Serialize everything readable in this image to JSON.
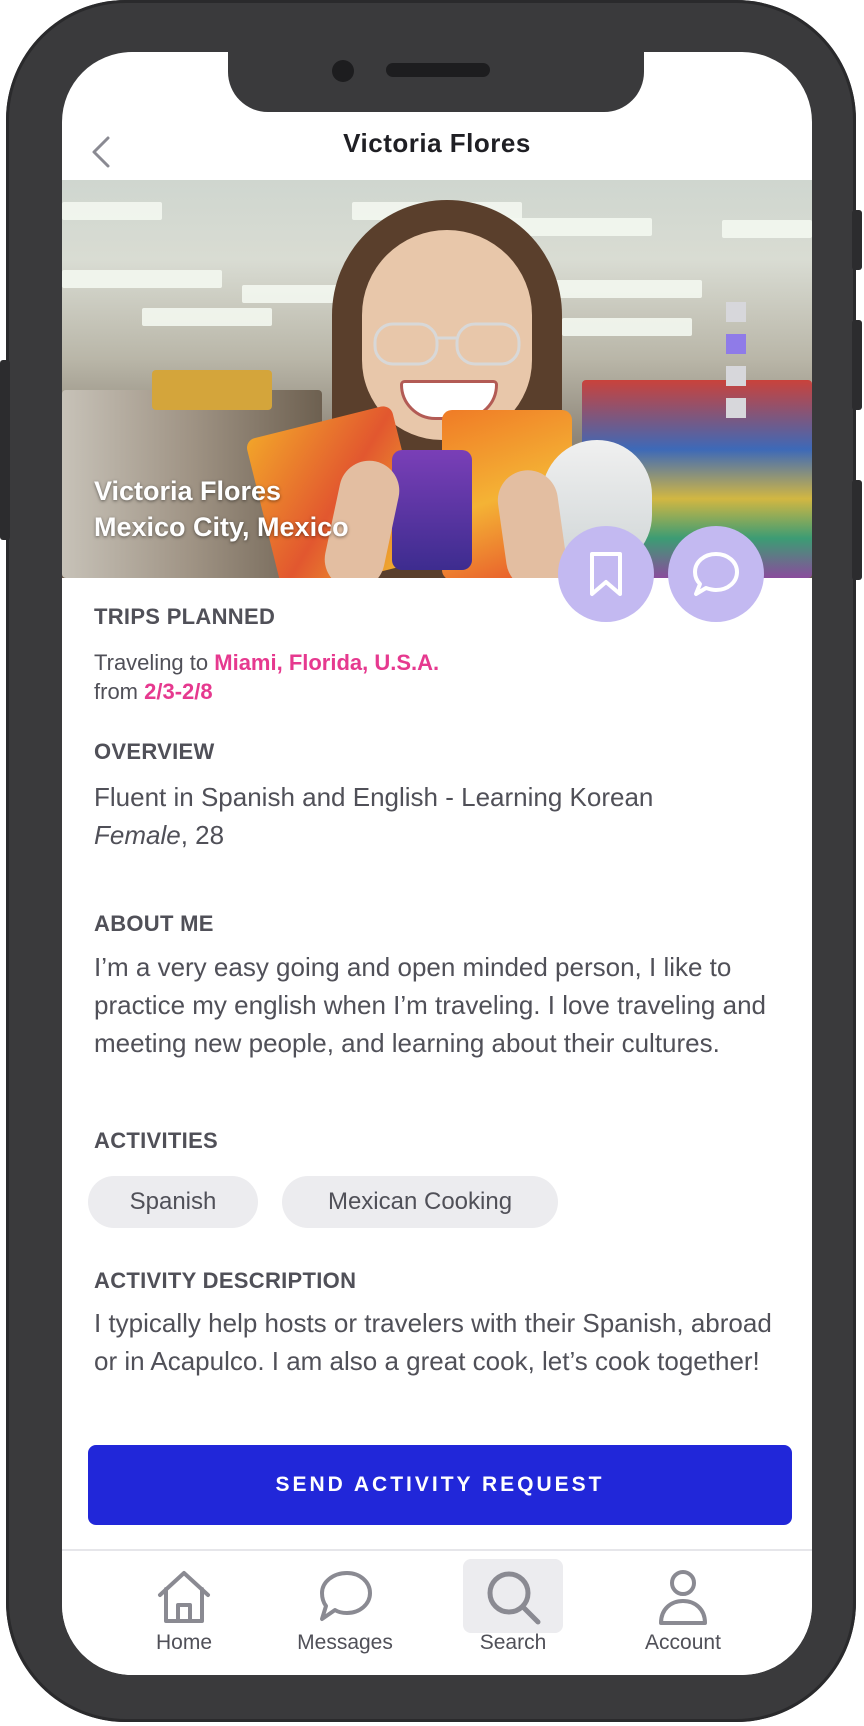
{
  "header": {
    "title": "Victoria Flores"
  },
  "profile": {
    "name": "Victoria Flores",
    "location": "Mexico City, Mexico",
    "photo_pages": 4,
    "active_photo": 2
  },
  "trips": {
    "label": "TRIPS PLANNED",
    "prefix": "Traveling to",
    "destination": "Miami, Florida, U.S.A.",
    "from_prefix": "from",
    "dates": "2/3-2/8"
  },
  "overview": {
    "label": "OVERVIEW",
    "languages": "Fluent in Spanish and English - Learning Korean",
    "gender": "Female",
    "age": ", 28"
  },
  "about": {
    "label": "ABOUT ME",
    "text": "I’m a very easy going and open minded person, I like to practice my english when I’m traveling. I love traveling and meeting new people, and learning about their cultures."
  },
  "activities": {
    "label": "ACTIVITIES",
    "items": [
      "Spanish",
      "Mexican Cooking"
    ]
  },
  "activity_description": {
    "label": "ACTIVITY DESCRIPTION",
    "text": "I typically help hosts or travelers with their Spanish, abroad or in Acapulco.  I am also a great cook, let’s cook together!"
  },
  "cta": {
    "label": "SEND ACTIVITY REQUEST"
  },
  "tabs": [
    {
      "label": "Home",
      "icon": "home-icon"
    },
    {
      "label": "Messages",
      "icon": "messages-icon"
    },
    {
      "label": "Search",
      "icon": "search-icon",
      "active": true
    },
    {
      "label": "Account",
      "icon": "account-icon"
    }
  ],
  "colors": {
    "accent": "#e6398f",
    "primary_button": "#2127d9",
    "fab": "#c3b9f1",
    "pager_active": "#8f7be8",
    "text": "#505058"
  }
}
